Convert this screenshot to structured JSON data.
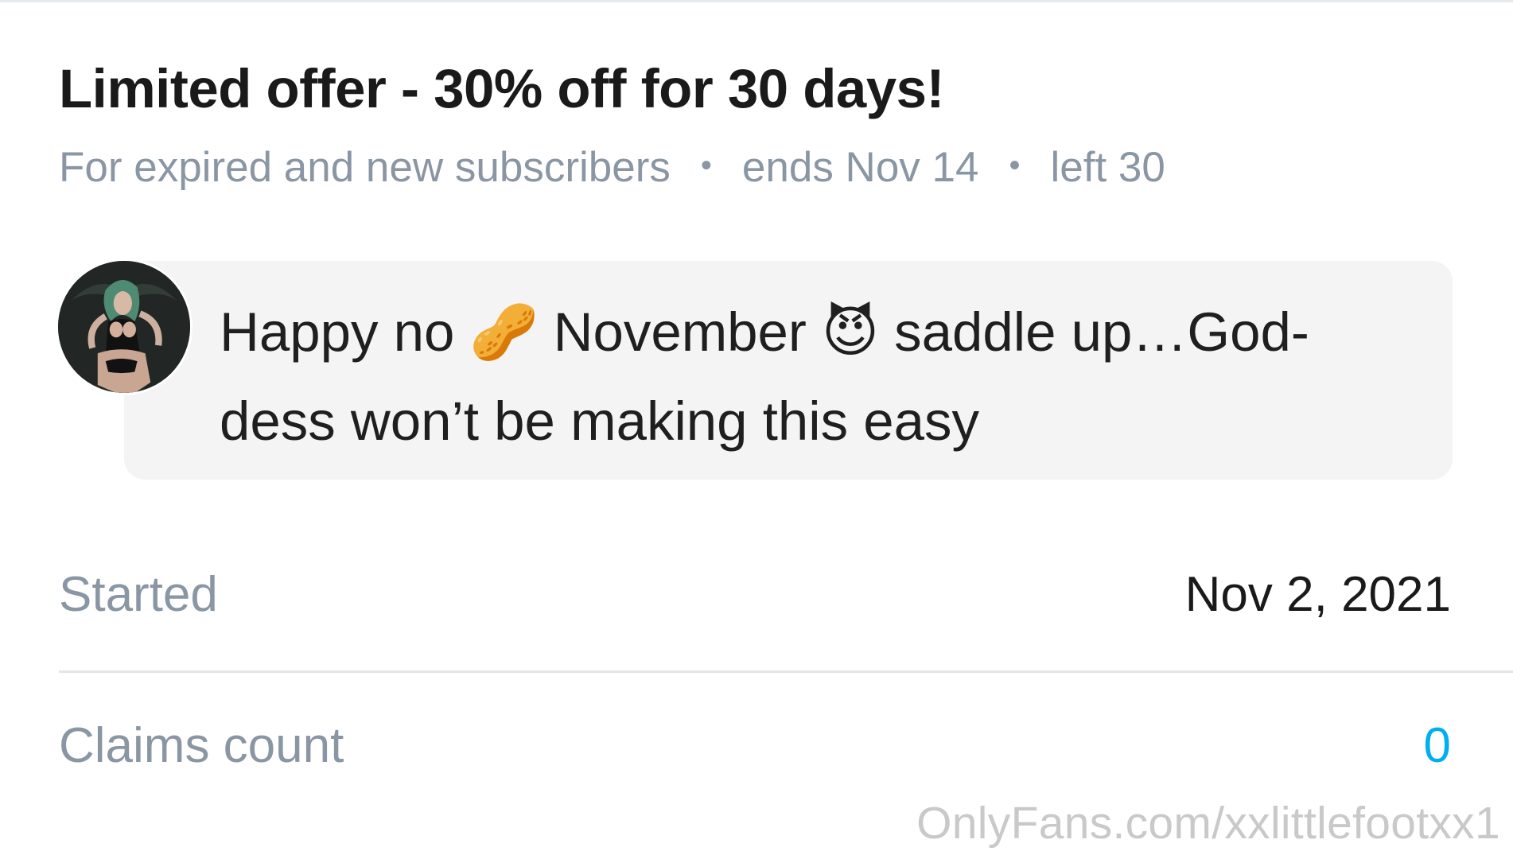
{
  "offer": {
    "title": "Limited offer - 30% off for 30 days!",
    "audience": "For expired and new subscribers",
    "separator": "•",
    "ends": "ends Nov 14",
    "left": "left 30"
  },
  "message": {
    "text": "Happy no 🥜 November 😈 saddle up…God-dess won’t be making this easy"
  },
  "details": {
    "started_label": "Started",
    "started_value": "Nov 2, 2021",
    "claims_label": "Claims count",
    "claims_value": "0"
  },
  "watermark": "OnlyFans.com/xxlittlefootxx1",
  "colors": {
    "accent": "#00aff0",
    "muted_text": "#8a96a3",
    "bubble_bg": "#f4f4f4",
    "divider": "#e3e6ea"
  },
  "icons": {
    "avatar": "user-avatar-image"
  }
}
